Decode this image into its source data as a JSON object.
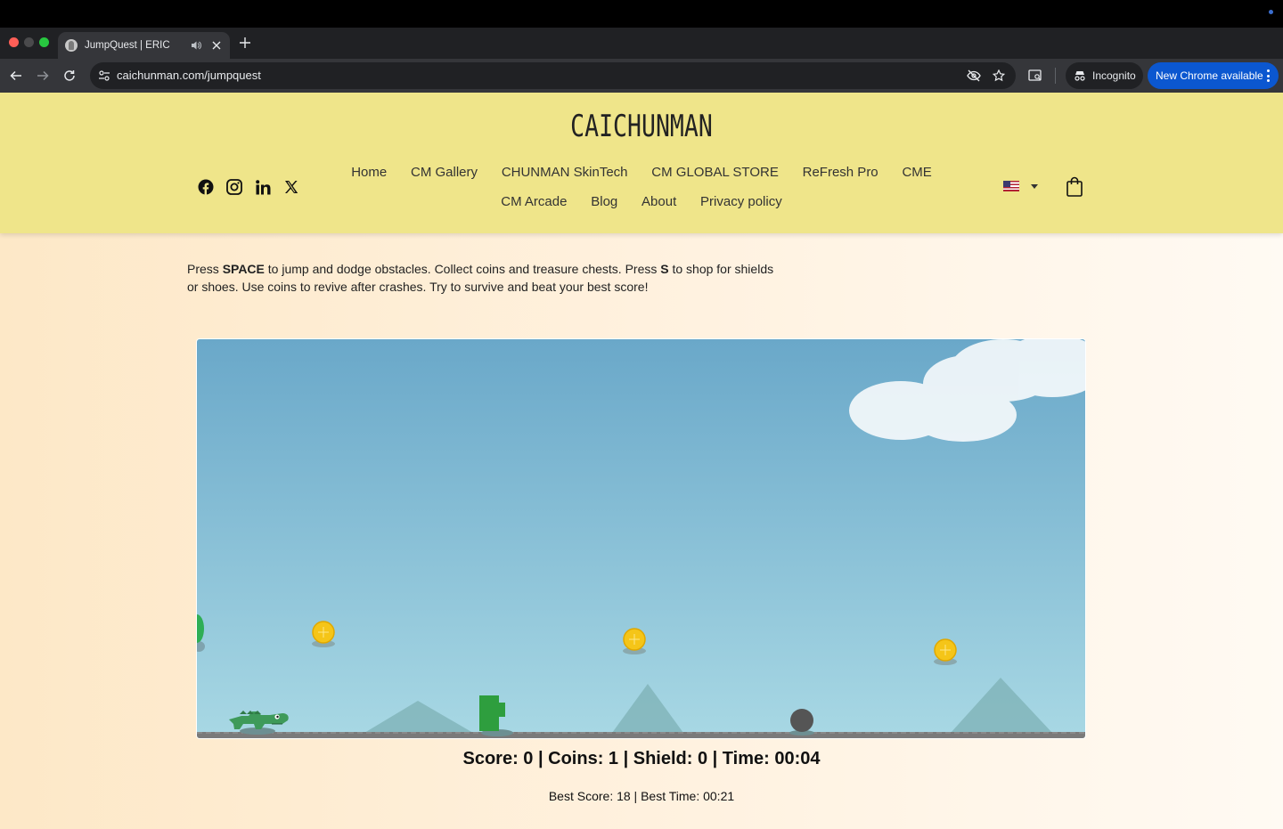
{
  "browser": {
    "tab_title": "JumpQuest | ERIC",
    "url": "caichunman.com/jumpquest",
    "incognito_label": "Incognito",
    "update_label": "New Chrome available"
  },
  "site": {
    "logo": "CAICHUNMAN",
    "nav_row1": [
      "Home",
      "CM Gallery",
      "CHUNMAN SkinTech",
      "CM GLOBAL STORE",
      "ReFresh Pro",
      "CME"
    ],
    "nav_row2": [
      "CM Arcade",
      "Blog",
      "About",
      "Privacy policy"
    ],
    "socials": [
      "facebook-icon",
      "instagram-icon",
      "linkedin-icon",
      "x-icon"
    ],
    "language_flag": "us-flag-icon"
  },
  "instructions": {
    "p1": "Press ",
    "k1": "SPACE",
    "p2": " to jump and dodge obstacles. Collect coins and treasure chests. Press ",
    "k2": "S",
    "p3": " to shop for shields or shoes. Use coins to revive after crashes. Try to survive and beat your best score!"
  },
  "game": {
    "score": 0,
    "coins": 1,
    "shield": 0,
    "time": "00:04",
    "best_score": 18,
    "best_time": "00:21",
    "hud_text": "Score: 0 | Coins: 1 | Shield: 0 | Time: 00:04",
    "best_text": "Best Score: 18 | Best Time: 00:21",
    "colors": {
      "sky_top": "#6aa8c9",
      "sky_bottom": "#a8d8e4",
      "ground": "#7a7a7a",
      "coin": "#f5c518",
      "obstacle": "#2e9e3e",
      "mountain": "#7fb3b8",
      "rock": "#555555",
      "player": "#3e9a5a"
    }
  }
}
